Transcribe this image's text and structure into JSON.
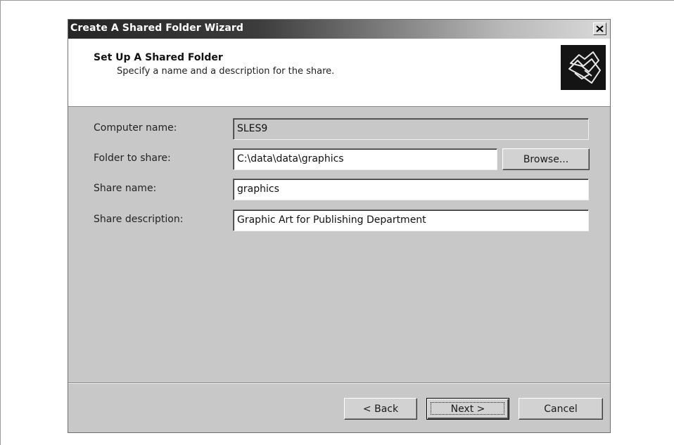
{
  "window": {
    "title": "Create A Shared Folder Wizard",
    "close_glyph": "✕"
  },
  "header": {
    "title": "Set Up A Shared Folder",
    "subtitle": "Specify a name and a description for the share.",
    "icon": "shared-folders-icon"
  },
  "form": {
    "computer_name_label": "Computer name:",
    "computer_name_value": "SLES9",
    "folder_label": "Folder to share:",
    "folder_value": "C:\\data\\data\\graphics",
    "browse_label": "Browse...",
    "share_name_label": "Share name:",
    "share_name_value": "graphics",
    "share_desc_label": "Share description:",
    "share_desc_value": "Graphic Art for Publishing Department"
  },
  "footer": {
    "back_label": "< Back",
    "next_label": "Next >",
    "cancel_label": "Cancel"
  },
  "colors": {
    "dialog_bg": "#c8c8c8",
    "titlebar_dark": "#262626",
    "titlebar_light": "#dadada",
    "header_bg": "#ffffff"
  }
}
